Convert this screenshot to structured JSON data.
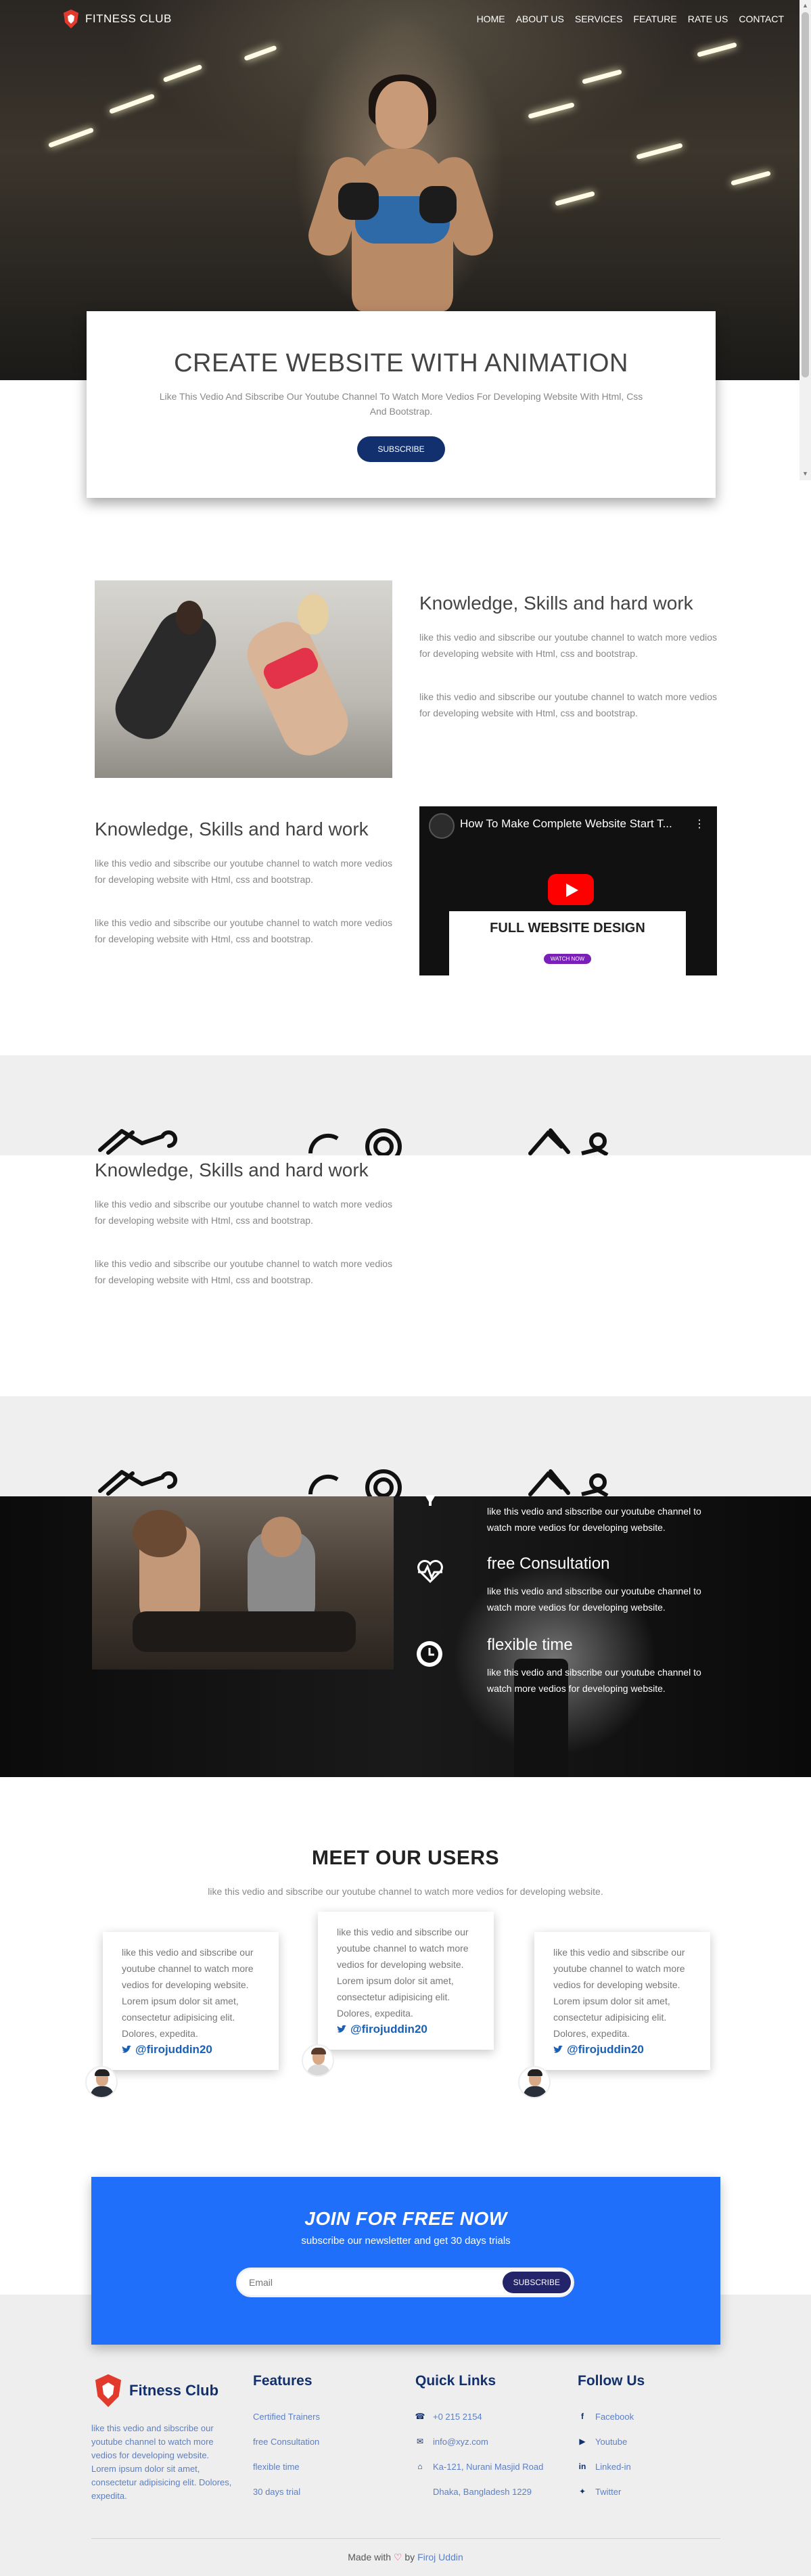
{
  "brand": {
    "name": "FITNESS CLUB"
  },
  "nav": [
    "HOME",
    "ABOUT US",
    "SERVICES",
    "FEATURE",
    "RATE US",
    "CONTACT"
  ],
  "hero": {
    "title": "CREATE WEBSITE WITH ANIMATION",
    "subtitle": "Like This Vedio And Sibscribe Our Youtube Channel To Watch More Vedios For Developing Website With Html, Css And Bootstrap.",
    "button": "SUBSCRIBE"
  },
  "features": [
    {
      "heading": "Knowledge, Skills and hard work",
      "paragraphs": [
        "like this vedio and sibscribe our youtube channel to watch more vedios for developing website with Html, css and bootstrap.",
        "like this vedio and sibscribe our youtube channel to watch more vedios for developing website with Html, css and bootstrap."
      ]
    },
    {
      "heading": "Knowledge, Skills and hard work",
      "paragraphs": [
        "like this vedio and sibscribe our youtube channel to watch more vedios for developing website with Html, css and bootstrap.",
        "like this vedio and sibscribe our youtube channel to watch more vedios for developing website with Html, css and bootstrap."
      ]
    },
    {
      "heading": "Knowledge, Skills and hard work",
      "paragraphs": [
        "like this vedio and sibscribe our youtube channel to watch more vedios for developing website with Html, css and bootstrap.",
        "like this vedio and sibscribe our youtube channel to watch more vedios for developing website with Html, css and bootstrap."
      ]
    }
  ],
  "video": {
    "title": "How To Make Complete Website Start T...",
    "banner_title": "FULL WEBSITE DESIGN",
    "banner_button": "WATCH NOW"
  },
  "services": [
    {
      "title": "",
      "text": "like this vedio and sibscribe our youtube channel to watch more vedios for developing website."
    },
    {
      "title": "free Consultation",
      "text": "like this vedio and sibscribe our youtube channel to watch more vedios for developing website."
    },
    {
      "title": "flexible time",
      "text": "like this vedio and sibscribe our youtube channel to watch more vedios for developing website."
    }
  ],
  "users": {
    "title": "MEET OUR USERS",
    "subtitle": "like this vedio and sibscribe our youtube channel to watch more vedios for developing website.",
    "testimonials": [
      {
        "text": "like this vedio and sibscribe our youtube channel to watch more vedios for developing website. Lorem ipsum dolor sit amet, consectetur adipisicing elit. Dolores, expedita.",
        "handle": "@firojuddin20"
      },
      {
        "text": "like this vedio and sibscribe our youtube channel to watch more vedios for developing website. Lorem ipsum dolor sit amet, consectetur adipisicing elit. Dolores, expedita.",
        "handle": "@firojuddin20"
      },
      {
        "text": "like this vedio and sibscribe our youtube channel to watch more vedios for developing website. Lorem ipsum dolor sit amet, consectetur adipisicing elit. Dolores, expedita.",
        "handle": "@firojuddin20"
      }
    ]
  },
  "join": {
    "title": "JOIN FOR FREE NOW",
    "subtitle": "subscribe our newsletter and get 30 days trials",
    "email_placeholder": "Email",
    "button": "SUBSCRIBE"
  },
  "footer": {
    "brand": "Fitness Club",
    "about": "like this vedio and sibscribe our youtube channel to watch more vedios for developing website. Lorem ipsum dolor sit amet, consectetur adipisicing elit. Dolores, expedita.",
    "features_heading": "Features",
    "features": [
      "Certified Trainers",
      "free Consultation",
      "flexible time",
      "30 days trial"
    ],
    "links_heading": "Quick Links",
    "links": [
      "+0 215 2154",
      "info@xyz.com",
      "Ka-121, Nurani Masjid Road",
      "Dhaka, Bangladesh 1229"
    ],
    "follow_heading": "Follow Us",
    "follow": [
      "Facebook",
      "Youtube",
      "Linked-in",
      "Twitter"
    ],
    "credit_prefix": "Made with",
    "credit_by": "by",
    "credit_author": "Firoj Uddin"
  },
  "colors": {
    "primary_dark": "#12306e",
    "join_blue": "#1f6ffb",
    "link_blue": "#5b7fc5",
    "youtube_red": "#ff0000"
  }
}
